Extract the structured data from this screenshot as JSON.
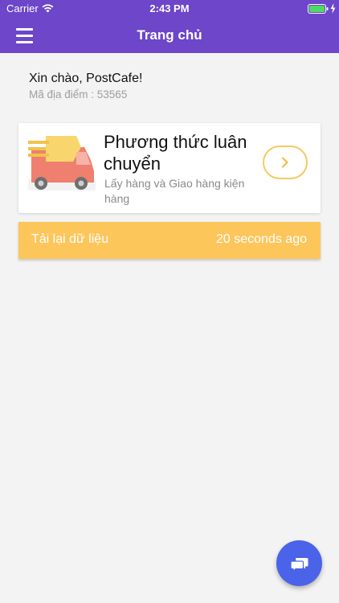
{
  "status_bar": {
    "carrier": "Carrier",
    "time": "2:43 PM"
  },
  "nav": {
    "title": "Trang chủ",
    "menu_icon": "hamburger-menu-icon"
  },
  "greeting": {
    "hello": "Xin chào, PostCafe!",
    "location_code": "Mã địa điểm : 53565"
  },
  "card": {
    "icon": "delivery-truck-icon",
    "title": "Phương thức luân chuyển",
    "subtitle": "Lấy hàng và Giao hàng kiện hàng",
    "action_icon": "chevron-right-icon"
  },
  "reload": {
    "label": "Tải lại dữ liệu",
    "time": "20 seconds ago"
  },
  "fab": {
    "icon": "chat-icon"
  },
  "colors": {
    "header": "#6d46c9",
    "accent_yellow": "#fdc65b",
    "fab_blue": "#4a63e8",
    "background": "#f3f3f3"
  }
}
